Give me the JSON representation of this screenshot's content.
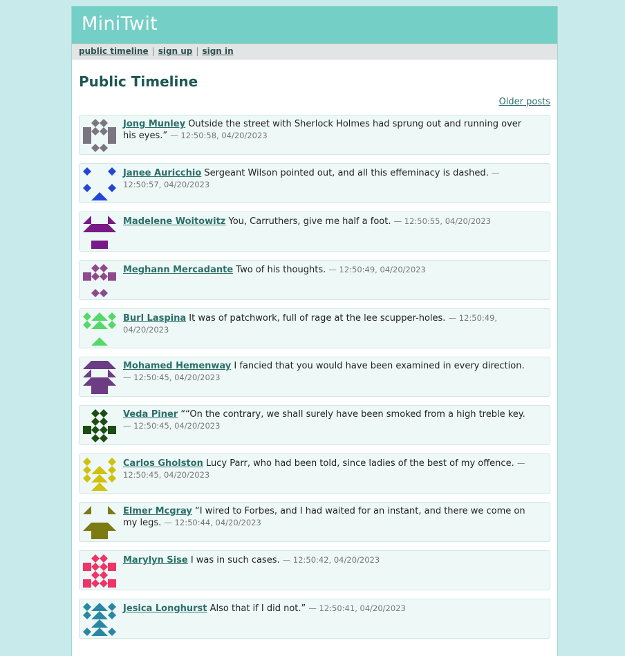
{
  "app": {
    "title": "MiniTwit"
  },
  "nav": {
    "public_timeline": "public timeline",
    "sign_up": "sign up",
    "sign_in": "sign in",
    "separator": "|"
  },
  "timeline": {
    "title": "Public Timeline",
    "older_posts": "Older posts"
  },
  "messages": [
    {
      "author": "Jong Munley",
      "text": "Outside the street with Sherlock Holmes had sprung out and running over his eyes.”",
      "timestamp": "— 12:50:58, 04/20/2023",
      "avatar_color": "#7a7580"
    },
    {
      "author": "Janee Auricchio",
      "text": "Sergeant Wilson pointed out, and all this effeminacy is dashed.",
      "timestamp": "— 12:50:57, 04/20/2023",
      "avatar_color": "#2346d6"
    },
    {
      "author": "Madelene Woitowitz",
      "text": "You, Carruthers, give me half a foot.",
      "timestamp": "— 12:50:55, 04/20/2023",
      "avatar_color": "#7a1a86"
    },
    {
      "author": "Meghann Mercadante",
      "text": "Two of his thoughts.",
      "timestamp": "— 12:50:49, 04/20/2023",
      "avatar_color": "#8e4a8e"
    },
    {
      "author": "Burl Laspina",
      "text": "It was of patchwork, full of rage at the lee scupper-holes.",
      "timestamp": "— 12:50:49, 04/20/2023",
      "avatar_color": "#56d866"
    },
    {
      "author": "Mohamed Hemenway",
      "text": "I fancied that you would have been examined in every direction.",
      "timestamp": "— 12:50:45, 04/20/2023",
      "avatar_color": "#6c3c84"
    },
    {
      "author": "Veda Piner",
      "text": "““On the contrary, we shall surely have been smoked from a high treble key.",
      "timestamp": "— 12:50:45, 04/20/2023",
      "avatar_color": "#1c4d12"
    },
    {
      "author": "Carlos Gholston",
      "text": "Lucy Parr, who had been told, since ladies of the best of my offence.",
      "timestamp": "— 12:50:45, 04/20/2023",
      "avatar_color": "#cfc10e"
    },
    {
      "author": "Elmer Mcgray",
      "text": "“I wired to Forbes, and I had waited for an instant, and there we come on my legs.",
      "timestamp": "— 12:50:44, 04/20/2023",
      "avatar_color": "#7c7a12"
    },
    {
      "author": "Marylyn Sise",
      "text": "I was in such cases.",
      "timestamp": "— 12:50:42, 04/20/2023",
      "avatar_color": "#f03468"
    },
    {
      "author": "Jesica Longhurst",
      "text": "Also that if I did not.”",
      "timestamp": "— 12:50:41, 04/20/2023",
      "avatar_color": "#2a87a4"
    }
  ]
}
